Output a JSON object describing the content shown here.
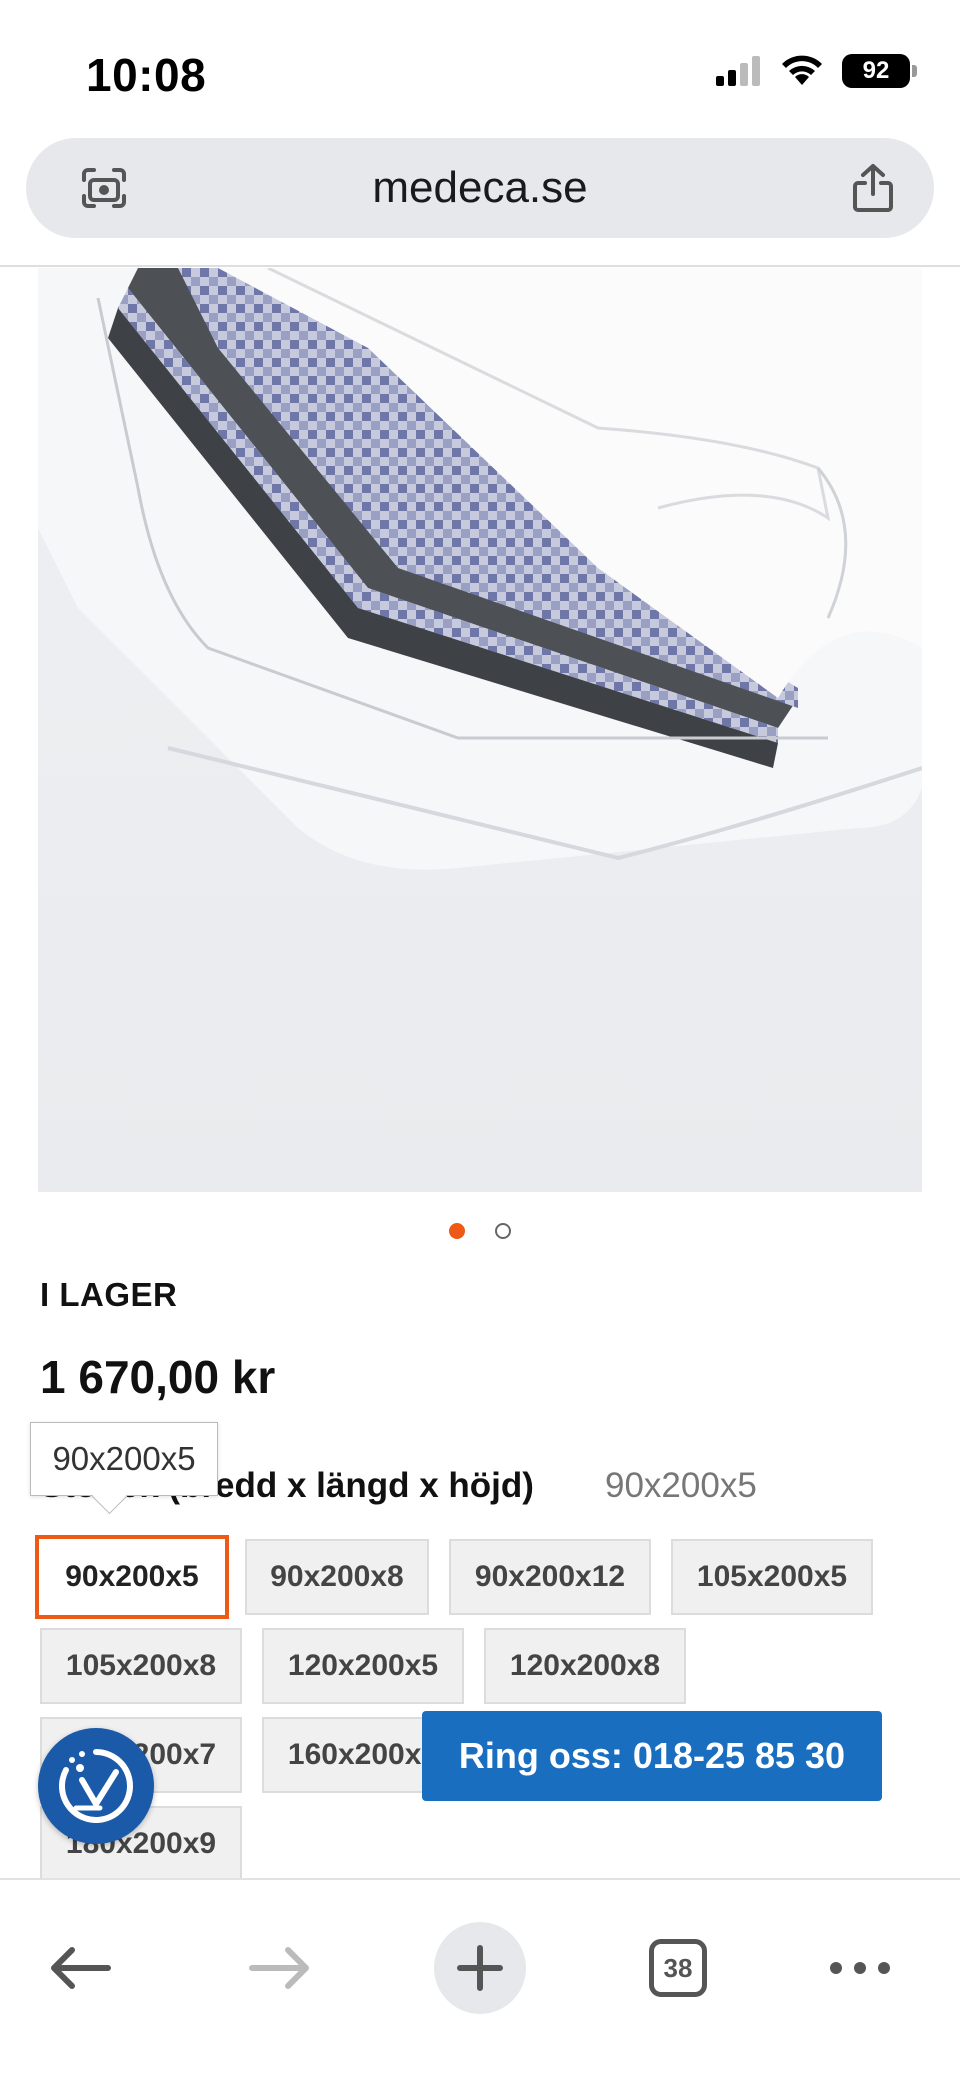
{
  "status_bar": {
    "time": "10:08",
    "battery": "92",
    "icons": [
      "cellular-signal-icon",
      "wifi-icon",
      "battery-icon"
    ]
  },
  "browser": {
    "url": "medeca.se",
    "icons": [
      "visual-search-icon",
      "share-icon"
    ]
  },
  "product": {
    "image_alt": "mattress-cover-photo",
    "carousel": {
      "count": 2,
      "active_index": 0
    },
    "stock_status": "I LAGER",
    "price": "1 670,00 kr",
    "size_label": "Storlek (bredd x längd x höjd)",
    "size_selected_value": "90x200x5",
    "tooltip": "90x200x5",
    "size_options": [
      "90x200x5",
      "90x200x8",
      "90x200x12",
      "105x200x5",
      "105x200x8",
      "120x200x5",
      "120x200x8",
      "160x200x7",
      "160x200x9",
      "180x200x9"
    ]
  },
  "floating": {
    "call_label": "Ring oss: 018-25 85 30",
    "accessibility_icon": "accessibility-icon"
  },
  "toolbar": {
    "tabs_count": "38",
    "icons": [
      "back-arrow-icon",
      "forward-arrow-icon",
      "new-tab-plus-icon",
      "tabs-icon",
      "more-icon"
    ]
  },
  "colors": {
    "accent": "#ee5a16",
    "call_button": "#1a6ec0",
    "accessibility": "#1a5aa8"
  }
}
